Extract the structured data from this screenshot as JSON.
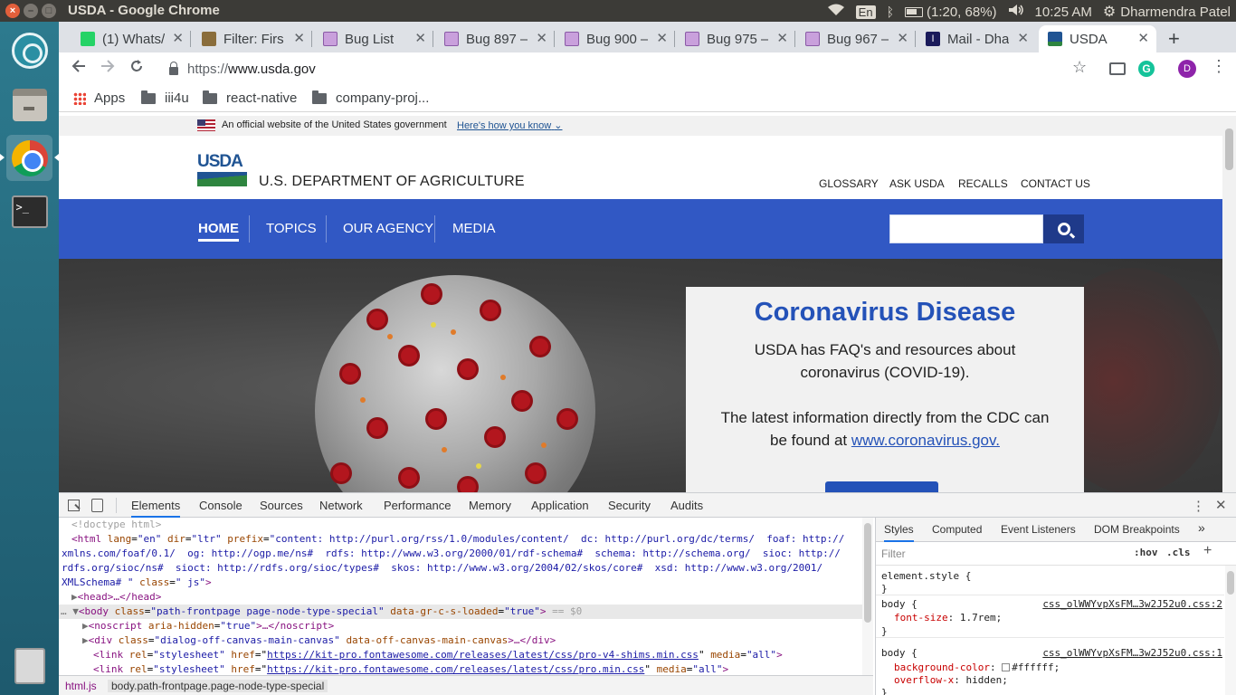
{
  "os": {
    "window_title": "USDA - Google Chrome",
    "keyboard": "En",
    "battery": "(1:20, 68%)",
    "time": "10:25 AM",
    "user": "Dharmendra Patel"
  },
  "tabs": [
    {
      "label": "(1) Whats/",
      "icon": "whatsapp-icon"
    },
    {
      "label": "Filter: Firs",
      "icon": "person-icon"
    },
    {
      "label": "Bug List",
      "icon": "bug-icon"
    },
    {
      "label": "Bug 897 –",
      "icon": "bug-icon"
    },
    {
      "label": "Bug 900 –",
      "icon": "bug-icon"
    },
    {
      "label": "Bug 975 –",
      "icon": "bug-icon"
    },
    {
      "label": "Bug 967 –",
      "icon": "bug-icon"
    },
    {
      "label": "Mail - Dha",
      "icon": "mail-icon"
    },
    {
      "label": "USDA",
      "icon": "usda-icon",
      "active": true
    }
  ],
  "toolbar": {
    "url_scheme": "https://",
    "url_host": "www.usda.gov",
    "avatar_initial": "D"
  },
  "bookmarks": [
    {
      "label": "Apps",
      "icon": "apps-grid-icon"
    },
    {
      "label": "iii4u",
      "icon": "folder-icon"
    },
    {
      "label": "react-native",
      "icon": "folder-icon"
    },
    {
      "label": "company-proj...",
      "icon": "folder-icon"
    }
  ],
  "site": {
    "gov_banner": "An official website of the United States government",
    "gov_banner_link": "Here's how you know",
    "logo_text": "USDA",
    "dept_name": "U.S. DEPARTMENT OF AGRICULTURE",
    "utility_links": [
      "GLOSSARY",
      "ASK USDA",
      "RECALLS",
      "CONTACT US"
    ],
    "nav": [
      "HOME",
      "TOPICS",
      "OUR AGENCY",
      "MEDIA"
    ],
    "card_title": "Coronavirus Disease",
    "card_p1": "USDA has FAQ's and resources about coronavirus (COVID-19).",
    "card_p2_prefix": "The latest information directly from the CDC can be found at ",
    "card_link": "www.coronavirus.gov.",
    "colors": {
      "nav_blue": "#3158c4",
      "title_blue": "#2452b8",
      "usda_green": "#2e8540"
    }
  },
  "devtools": {
    "tabs": [
      "Elements",
      "Console",
      "Sources",
      "Network",
      "Performance",
      "Memory",
      "Application",
      "Security",
      "Audits"
    ],
    "active_tab": "Elements",
    "dom": {
      "doctype": "<!doctype html>",
      "html_open_1": "<html ",
      "html_lang_attr": "lang",
      "html_lang_val": "\"en\"",
      "html_dir_attr": "dir",
      "html_dir_val": "\"ltr\"",
      "html_prefix_attr": "prefix",
      "html_prefix_line1": "\"content: http://purl.org/rss/1.0/modules/content/  dc: http://purl.org/dc/terms/  foaf: http://",
      "html_prefix_line2": "xmlns.com/foaf/0.1/  og: http://ogp.me/ns#  rdfs: http://www.w3.org/2000/01/rdf-schema#  schema: http://schema.org/  sioc: http://",
      "html_prefix_line3": "rdfs.org/sioc/ns#  sioct: http://rdfs.org/sioc/types#  skos: http://www.w3.org/2004/02/skos/core#  xsd: http://www.w3.org/2001/",
      "html_prefix_line4": "XMLSchema# \"",
      "html_class_attr": "class",
      "html_class_val": "\" js\"",
      "head": "<head>…</head>",
      "body_tag": "body",
      "body_class_attr": "class",
      "body_class_val": "\"path-frontpage page-node-type-special\"",
      "body_data_attr": "data-gr-c-s-loaded",
      "body_data_val": "\"true\"",
      "body_suffix": "== $0",
      "noscript_tag": "noscript",
      "noscript_attr": "aria-hidden",
      "noscript_val": "\"true\"",
      "noscript_rest": ">…</noscript>",
      "div_tag": "div",
      "div_class_attr": "class",
      "div_class_val": "\"dialog-off-canvas-main-canvas\"",
      "div_data_attr": "data-off-canvas-main-canvas",
      "div_rest": ">…</div>",
      "link1_url": "https://kit-pro.fontawesome.com/releases/latest/css/pro-v4-shims.min.css",
      "link2_url": "https://kit-pro.fontawesome.com/releases/latest/css/pro.min.css",
      "link_rel_val": "\"stylesheet\"",
      "link_media_val": "\"all\""
    },
    "breadcrumb": [
      "html.js",
      "body.path-frontpage.page-node-type-special"
    ],
    "styles": {
      "tabs": [
        "Styles",
        "Computed",
        "Event Listeners",
        "DOM Breakpoints"
      ],
      "filter_placeholder": "Filter",
      "hov": ":hov",
      "cls": ".cls",
      "rule1_selector": "element.style {",
      "rule2_selector": "body {",
      "rule2_source": "css_olWWYvpXsFM…3w2J52u0.css:2",
      "rule2_prop": "font-size",
      "rule2_value": "1.7rem;",
      "rule3_selector": "body {",
      "rule3_source": "css_olWWYvpXsFM…3w2J52u0.css:1",
      "rule3_prop1": "background-color",
      "rule3_value1": "#ffffff;",
      "rule3_prop2": "overflow-x",
      "rule3_value2": "hidden;"
    }
  }
}
